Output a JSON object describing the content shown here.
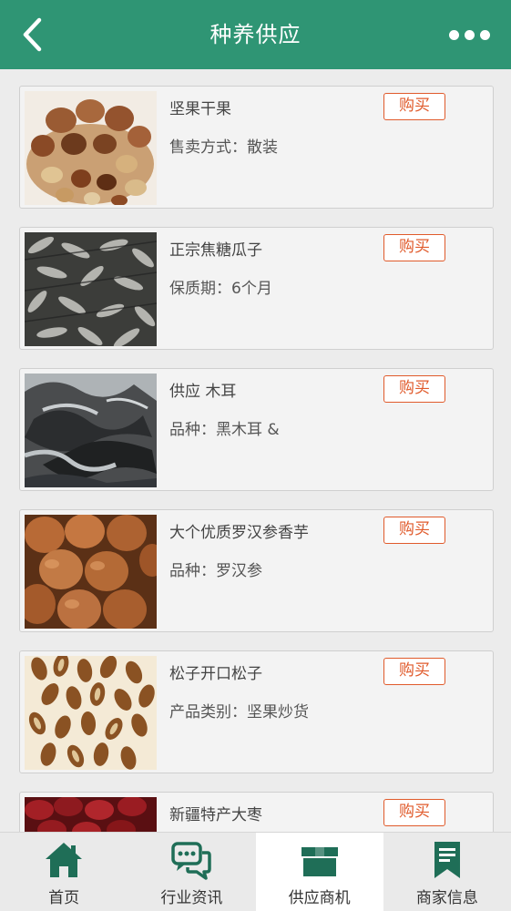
{
  "header": {
    "title": "种养供应",
    "back_icon": "chevron-left-icon",
    "more_icon": "more-dots-icon",
    "color": "#2f9574"
  },
  "products": [
    {
      "title": "坚果干果",
      "spec": "售卖方式：散装",
      "buy_label": "购买",
      "image": "mixed-nuts"
    },
    {
      "title": "正宗焦糖瓜子",
      "spec": "保质期：6个月",
      "buy_label": "购买",
      "image": "sunflower-seeds"
    },
    {
      "title": "供应 木耳",
      "spec": "品种：黑木耳 &",
      "buy_label": "购买",
      "image": "black-fungus"
    },
    {
      "title": "大个优质罗汉参香芋",
      "spec": "品种：罗汉参",
      "buy_label": "购买",
      "image": "luohan-nuts"
    },
    {
      "title": "松子开口松子",
      "spec": "产品类别：坚果炒货",
      "buy_label": "购买",
      "image": "pine-nuts"
    },
    {
      "title": "新疆特产大枣",
      "spec": "",
      "buy_label": "购买",
      "image": "red-dates"
    }
  ],
  "tabbar": {
    "items": [
      {
        "label": "首页",
        "icon": "home-icon"
      },
      {
        "label": "行业资讯",
        "icon": "chat-bubbles-icon"
      },
      {
        "label": "供应商机",
        "icon": "box-icon",
        "active": true
      },
      {
        "label": "商家信息",
        "icon": "document-icon"
      }
    ],
    "icon_color": "#1f6e57",
    "accent": "#e05a2b"
  }
}
